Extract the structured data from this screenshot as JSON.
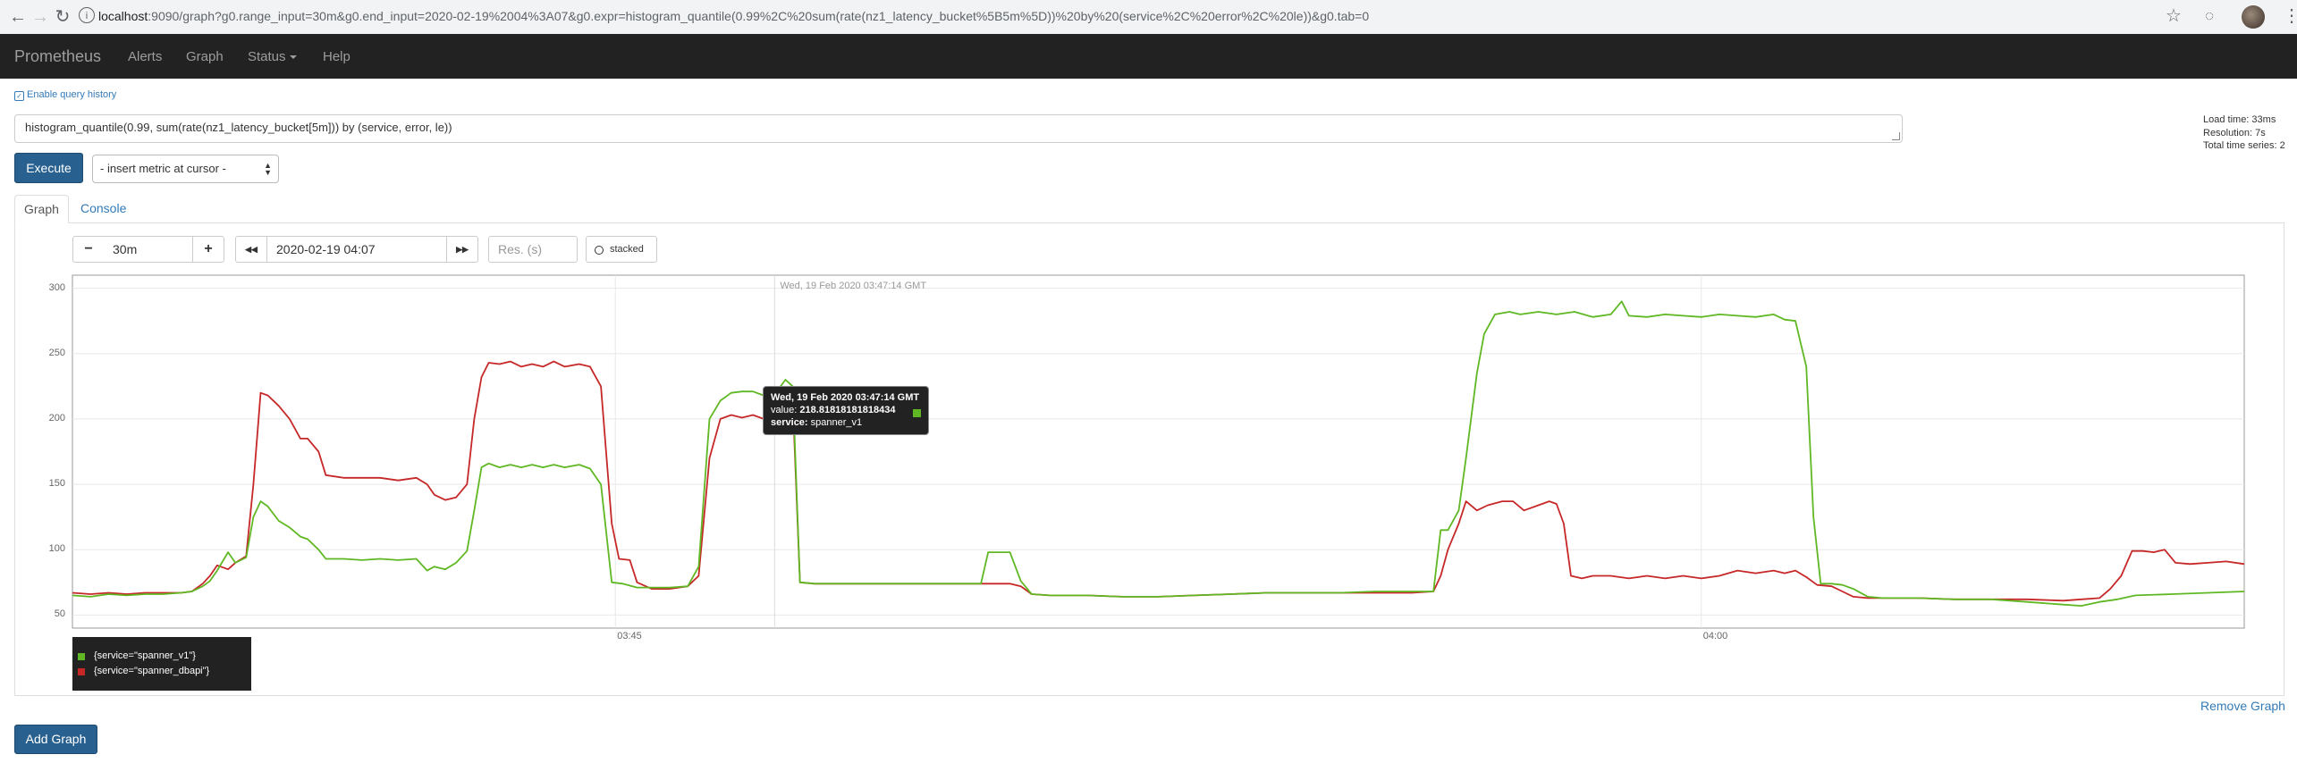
{
  "browser": {
    "url_host": "localhost",
    "url_rest": ":9090/graph?g0.range_input=30m&g0.end_input=2020-02-19%2004%3A07&g0.expr=histogram_quantile(0.99%2C%20sum(rate(nz1_latency_bucket%5B5m%5D))%20by%20(service%2C%20error%2C%20le))&g0.tab=0"
  },
  "navbar": {
    "brand": "Prometheus",
    "links": [
      "Alerts",
      "Graph",
      "Status",
      "Help"
    ]
  },
  "history_label": "Enable query history",
  "expression": "histogram_quantile(0.99, sum(rate(nz1_latency_bucket[5m])) by (service, error, le))",
  "stats": {
    "load_time": "Load time: 33ms",
    "resolution": "Resolution: 7s",
    "total_series": "Total time series: 2"
  },
  "execute_label": "Execute",
  "metric_select": "- insert metric at cursor -",
  "tabs": {
    "graph": "Graph",
    "console": "Console"
  },
  "controls": {
    "minus": "−",
    "range": "30m",
    "plus": "+",
    "back": "◀◀",
    "end_time": "2020-02-19 04:07",
    "forward": "▶▶",
    "res_placeholder": "Res. (s)",
    "stacked": "stacked"
  },
  "hover_time_label": "Wed, 19 Feb 2020 03:47:14 GMT",
  "tooltip": {
    "time": "Wed, 19 Feb 2020 03:47:14 GMT",
    "value_label": "value:",
    "value": "218.81818181818434",
    "service_label": "service:",
    "service": "spanner_v1"
  },
  "legend": [
    {
      "label": "{service=\"spanner_v1\"}",
      "color": "#5fb823"
    },
    {
      "label": "{service=\"spanner_dbapi\"}",
      "color": "#c62828"
    }
  ],
  "remove_graph": "Remove Graph",
  "add_graph": "Add Graph",
  "chart_data": {
    "type": "line",
    "x_range": [
      "03:37",
      "04:07"
    ],
    "y_ticks": [
      50,
      100,
      150,
      200,
      250,
      300
    ],
    "x_ticks": [
      "03:45",
      "04:00"
    ],
    "ylim": [
      40,
      310
    ],
    "grid": true,
    "series": [
      {
        "name": "{service=\"spanner_v1\"}",
        "color": "#5fb823",
        "points": [
          [
            0,
            65
          ],
          [
            0.5,
            64
          ],
          [
            1,
            66
          ],
          [
            1.5,
            65
          ],
          [
            2,
            66
          ],
          [
            2.5,
            66
          ],
          [
            3,
            67
          ],
          [
            3.3,
            68
          ],
          [
            3.6,
            72
          ],
          [
            3.8,
            76
          ],
          [
            4.0,
            84
          ],
          [
            4.3,
            98
          ],
          [
            4.5,
            90
          ],
          [
            4.8,
            94
          ],
          [
            5.0,
            125
          ],
          [
            5.2,
            137
          ],
          [
            5.4,
            133
          ],
          [
            5.7,
            122
          ],
          [
            6.0,
            117
          ],
          [
            6.3,
            110
          ],
          [
            6.5,
            108
          ],
          [
            6.8,
            100
          ],
          [
            7.0,
            93
          ],
          [
            7.5,
            93
          ],
          [
            8.0,
            92
          ],
          [
            8.5,
            93
          ],
          [
            9.0,
            92
          ],
          [
            9.5,
            93
          ],
          [
            9.8,
            84
          ],
          [
            10.0,
            87
          ],
          [
            10.3,
            85
          ],
          [
            10.6,
            90
          ],
          [
            10.9,
            99
          ],
          [
            11.1,
            130
          ],
          [
            11.3,
            163
          ],
          [
            11.5,
            166
          ],
          [
            11.8,
            163
          ],
          [
            12.1,
            165
          ],
          [
            12.4,
            163
          ],
          [
            12.7,
            165
          ],
          [
            13.0,
            163
          ],
          [
            13.3,
            165
          ],
          [
            13.6,
            163
          ],
          [
            14.0,
            165
          ],
          [
            14.3,
            162
          ],
          [
            14.6,
            150
          ],
          [
            14.9,
            75
          ],
          [
            15.2,
            74
          ],
          [
            15.6,
            71
          ],
          [
            16.0,
            71
          ],
          [
            16.5,
            71
          ],
          [
            17.0,
            72
          ],
          [
            17.3,
            87
          ],
          [
            17.6,
            200
          ],
          [
            17.9,
            214
          ],
          [
            18.2,
            220
          ],
          [
            18.5,
            221
          ],
          [
            18.8,
            221
          ],
          [
            19.1,
            218
          ],
          [
            19.4,
            218.8
          ],
          [
            19.7,
            230
          ],
          [
            19.9,
            225
          ],
          [
            20.1,
            75
          ],
          [
            20.5,
            74
          ],
          [
            21,
            74
          ],
          [
            22,
            74
          ],
          [
            23,
            74
          ],
          [
            24,
            74
          ],
          [
            25,
            74
          ],
          [
            25.1,
            74
          ],
          [
            25.3,
            98
          ],
          [
            25.6,
            98
          ],
          [
            25.9,
            98
          ],
          [
            26.2,
            76
          ],
          [
            26.5,
            66
          ],
          [
            27,
            65
          ],
          [
            28,
            65
          ],
          [
            29,
            64
          ],
          [
            30,
            64
          ],
          [
            31,
            65
          ],
          [
            32,
            66
          ],
          [
            33,
            67
          ],
          [
            34,
            67
          ],
          [
            35,
            67
          ],
          [
            36,
            68
          ],
          [
            37,
            68
          ],
          [
            37.6,
            68
          ],
          [
            37.8,
            115
          ],
          [
            38.0,
            115
          ],
          [
            38.3,
            130
          ],
          [
            38.5,
            170
          ],
          [
            38.8,
            235
          ],
          [
            39.0,
            265
          ],
          [
            39.3,
            280
          ],
          [
            39.7,
            282
          ],
          [
            40.0,
            280
          ],
          [
            40.5,
            282
          ],
          [
            41,
            280
          ],
          [
            41.5,
            282
          ],
          [
            42.0,
            278
          ],
          [
            42.5,
            280
          ],
          [
            42.8,
            290
          ],
          [
            43.0,
            279
          ],
          [
            43.5,
            278
          ],
          [
            44,
            280
          ],
          [
            44.5,
            279
          ],
          [
            45,
            278
          ],
          [
            45.5,
            280
          ],
          [
            46,
            279
          ],
          [
            46.5,
            278
          ],
          [
            47,
            280
          ],
          [
            47.3,
            276
          ],
          [
            47.6,
            275
          ],
          [
            47.9,
            240
          ],
          [
            48.1,
            125
          ],
          [
            48.3,
            74
          ],
          [
            48.6,
            74
          ],
          [
            48.9,
            73
          ],
          [
            49.2,
            70
          ],
          [
            49.6,
            64
          ],
          [
            50,
            63
          ],
          [
            51,
            63
          ],
          [
            52,
            62
          ],
          [
            53,
            62
          ],
          [
            54,
            60
          ],
          [
            55,
            58
          ],
          [
            55.5,
            57
          ],
          [
            56,
            60
          ],
          [
            56.5,
            62
          ],
          [
            57,
            65
          ],
          [
            58,
            66
          ],
          [
            59,
            67
          ],
          [
            60,
            68
          ]
        ]
      },
      {
        "name": "{service=\"spanner_dbapi\"}",
        "color": "#c62828",
        "points": [
          [
            0,
            67
          ],
          [
            0.5,
            66
          ],
          [
            1,
            67
          ],
          [
            1.5,
            66
          ],
          [
            2,
            67
          ],
          [
            2.5,
            67
          ],
          [
            3,
            67
          ],
          [
            3.3,
            68
          ],
          [
            3.6,
            74
          ],
          [
            3.8,
            80
          ],
          [
            4.0,
            88
          ],
          [
            4.3,
            85
          ],
          [
            4.5,
            90
          ],
          [
            4.8,
            95
          ],
          [
            5.0,
            150
          ],
          [
            5.2,
            220
          ],
          [
            5.4,
            218
          ],
          [
            5.7,
            210
          ],
          [
            6.0,
            200
          ],
          [
            6.3,
            185
          ],
          [
            6.5,
            185
          ],
          [
            6.8,
            175
          ],
          [
            7.0,
            157
          ],
          [
            7.5,
            155
          ],
          [
            8.0,
            155
          ],
          [
            8.5,
            155
          ],
          [
            9.0,
            153
          ],
          [
            9.5,
            155
          ],
          [
            9.8,
            150
          ],
          [
            10.0,
            142
          ],
          [
            10.3,
            138
          ],
          [
            10.6,
            140
          ],
          [
            10.9,
            150
          ],
          [
            11.1,
            200
          ],
          [
            11.3,
            232
          ],
          [
            11.5,
            243
          ],
          [
            11.8,
            242
          ],
          [
            12.1,
            244
          ],
          [
            12.4,
            240
          ],
          [
            12.7,
            242
          ],
          [
            13.0,
            240
          ],
          [
            13.3,
            244
          ],
          [
            13.6,
            240
          ],
          [
            14.0,
            242
          ],
          [
            14.3,
            240
          ],
          [
            14.6,
            225
          ],
          [
            14.9,
            120
          ],
          [
            15.1,
            93
          ],
          [
            15.4,
            92
          ],
          [
            15.6,
            75
          ],
          [
            16.0,
            70
          ],
          [
            16.5,
            70
          ],
          [
            17.0,
            72
          ],
          [
            17.3,
            80
          ],
          [
            17.6,
            170
          ],
          [
            17.9,
            200
          ],
          [
            18.2,
            203
          ],
          [
            18.5,
            201
          ],
          [
            18.8,
            203
          ],
          [
            19.1,
            200
          ],
          [
            19.4,
            203
          ],
          [
            19.7,
            220
          ],
          [
            19.9,
            215
          ],
          [
            20.1,
            75
          ],
          [
            20.5,
            74
          ],
          [
            21,
            74
          ],
          [
            22,
            74
          ],
          [
            23,
            74
          ],
          [
            24,
            74
          ],
          [
            25,
            74
          ],
          [
            25.3,
            74
          ],
          [
            25.6,
            74
          ],
          [
            25.9,
            74
          ],
          [
            26.2,
            72
          ],
          [
            26.5,
            66
          ],
          [
            27,
            65
          ],
          [
            28,
            65
          ],
          [
            29,
            64
          ],
          [
            30,
            64
          ],
          [
            31,
            65
          ],
          [
            32,
            66
          ],
          [
            33,
            67
          ],
          [
            34,
            67
          ],
          [
            35,
            67
          ],
          [
            36,
            67
          ],
          [
            37,
            67
          ],
          [
            37.6,
            68
          ],
          [
            37.8,
            80
          ],
          [
            38.0,
            100
          ],
          [
            38.3,
            120
          ],
          [
            38.5,
            137
          ],
          [
            38.8,
            130
          ],
          [
            39.1,
            134
          ],
          [
            39.5,
            137
          ],
          [
            39.8,
            137
          ],
          [
            40.1,
            130
          ],
          [
            40.5,
            134
          ],
          [
            40.8,
            137
          ],
          [
            41.0,
            135
          ],
          [
            41.2,
            120
          ],
          [
            41.4,
            80
          ],
          [
            41.7,
            78
          ],
          [
            42.0,
            80
          ],
          [
            42.5,
            80
          ],
          [
            43,
            78
          ],
          [
            43.5,
            80
          ],
          [
            44,
            78
          ],
          [
            44.5,
            80
          ],
          [
            45,
            78
          ],
          [
            45.5,
            80
          ],
          [
            46,
            84
          ],
          [
            46.5,
            82
          ],
          [
            47,
            84
          ],
          [
            47.3,
            82
          ],
          [
            47.6,
            84
          ],
          [
            47.9,
            79
          ],
          [
            48.2,
            73
          ],
          [
            48.6,
            72
          ],
          [
            48.9,
            68
          ],
          [
            49.2,
            64
          ],
          [
            49.6,
            63
          ],
          [
            50,
            63
          ],
          [
            51,
            63
          ],
          [
            52,
            62
          ],
          [
            53,
            62
          ],
          [
            54,
            62
          ],
          [
            55,
            61
          ],
          [
            55.5,
            62
          ],
          [
            56,
            63
          ],
          [
            56.3,
            70
          ],
          [
            56.6,
            80
          ],
          [
            56.9,
            99
          ],
          [
            57.2,
            99
          ],
          [
            57.5,
            98
          ],
          [
            57.8,
            100
          ],
          [
            58.1,
            90
          ],
          [
            58.5,
            89
          ],
          [
            59,
            90
          ],
          [
            59.5,
            91
          ],
          [
            60,
            89
          ]
        ]
      }
    ],
    "hover": {
      "x": 19.4,
      "y": 218.8
    }
  }
}
